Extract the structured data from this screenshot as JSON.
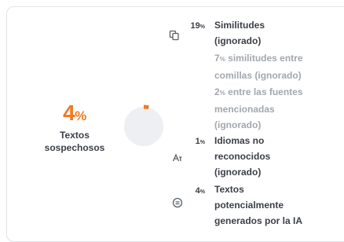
{
  "summary": {
    "percent_value": "4",
    "percent_unit": "%",
    "label_line1": "Textos",
    "label_line2": "sospechosos"
  },
  "donut": {
    "fraction": 0.04,
    "accent_color": "#f07a22",
    "track_color": "#eeeff2"
  },
  "items": [
    {
      "icon": "copy-icon",
      "percent": "19",
      "unit": "%",
      "lines": [
        "Similitudes",
        "(ignorado)"
      ]
    },
    {
      "icon": "language-icon",
      "percent": "1",
      "unit": "%",
      "lines": [
        "Idiomas no",
        "reconocidos",
        "(ignorado)"
      ]
    },
    {
      "icon": "ai-icon",
      "percent": "4",
      "unit": "%",
      "lines": [
        "Textos",
        "potencialmente",
        "generados por la IA"
      ]
    }
  ],
  "sub_items": [
    {
      "percent": "7",
      "unit": "%",
      "first_line": "similitudes entre",
      "rest": [
        "comillas (ignorado)"
      ]
    },
    {
      "percent": "2",
      "unit": "%",
      "first_line": "entre las fuentes",
      "rest": [
        "mencionadas",
        "(ignorado)"
      ]
    }
  ],
  "colors": {
    "accent": "#f07a22",
    "text": "#3b3f47",
    "muted": "#a3a7ae",
    "border": "#e3e5ea"
  }
}
